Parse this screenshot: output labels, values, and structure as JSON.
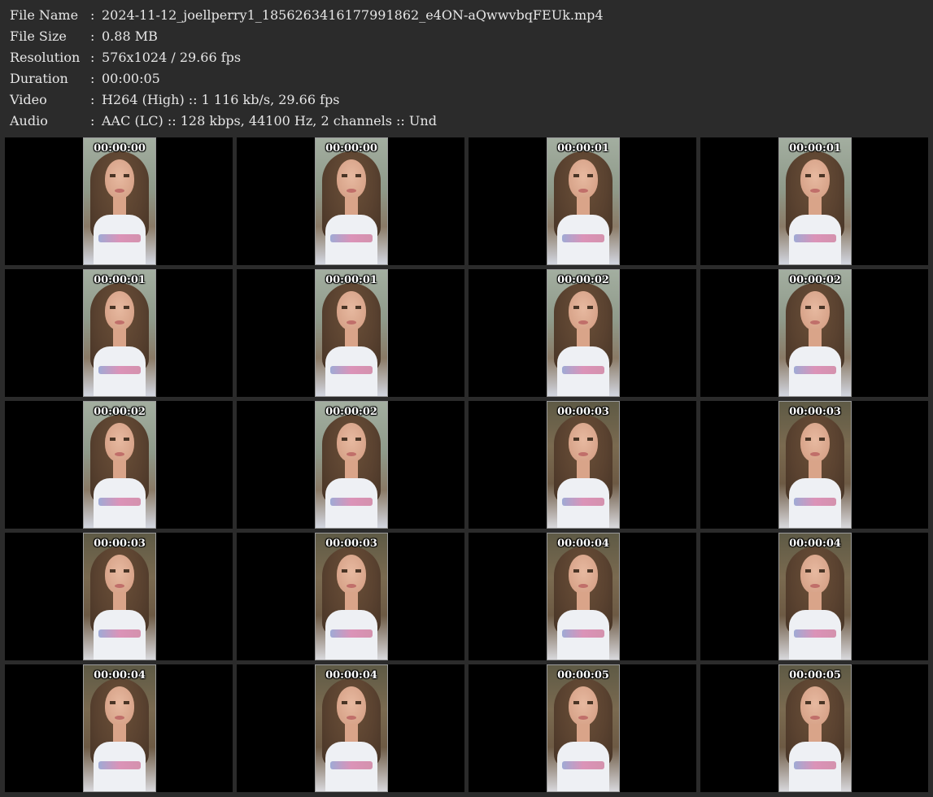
{
  "info": [
    {
      "label": "File Name",
      "value": "2024-11-12_joellperry1_1856263416177991862_e4ON-aQwwvbqFEUk.mp4"
    },
    {
      "label": "File Size",
      "value": "0.88 MB"
    },
    {
      "label": "Resolution",
      "value": "576x1024 / 29.66 fps"
    },
    {
      "label": "Duration",
      "value": "00:00:05"
    },
    {
      "label": "Video",
      "value": "H264 (High) :: 1 116 kb/s, 29.66 fps"
    },
    {
      "label": "Audio",
      "value": "AAC (LC) :: 128 kbps, 44100 Hz, 2 channels :: Und"
    }
  ],
  "separator": ":",
  "thumbnails": [
    {
      "time": "00:00:00",
      "tone": "cool"
    },
    {
      "time": "00:00:00",
      "tone": "cool"
    },
    {
      "time": "00:00:01",
      "tone": "cool"
    },
    {
      "time": "00:00:01",
      "tone": "cool"
    },
    {
      "time": "00:00:01",
      "tone": "cool"
    },
    {
      "time": "00:00:01",
      "tone": "cool"
    },
    {
      "time": "00:00:02",
      "tone": "cool"
    },
    {
      "time": "00:00:02",
      "tone": "cool"
    },
    {
      "time": "00:00:02",
      "tone": "cool"
    },
    {
      "time": "00:00:02",
      "tone": "cool"
    },
    {
      "time": "00:00:03",
      "tone": "warm"
    },
    {
      "time": "00:00:03",
      "tone": "warm"
    },
    {
      "time": "00:00:03",
      "tone": "warm"
    },
    {
      "time": "00:00:03",
      "tone": "warm"
    },
    {
      "time": "00:00:04",
      "tone": "warm"
    },
    {
      "time": "00:00:04",
      "tone": "warm"
    },
    {
      "time": "00:00:04",
      "tone": "warm"
    },
    {
      "time": "00:00:04",
      "tone": "warm"
    },
    {
      "time": "00:00:05",
      "tone": "warm"
    },
    {
      "time": "00:00:05",
      "tone": "warm"
    }
  ]
}
